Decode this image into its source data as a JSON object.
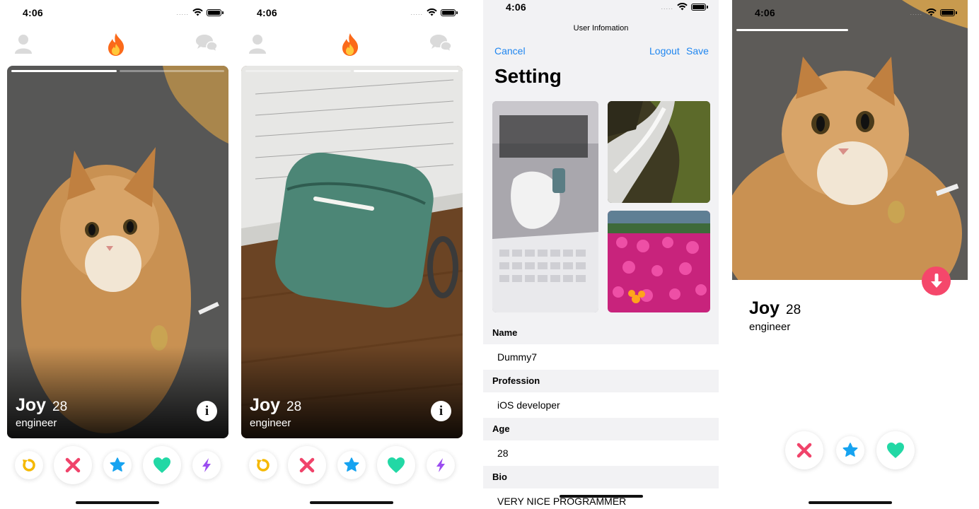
{
  "status_bar": {
    "time": "4:06",
    "signal_dots": "....."
  },
  "card": {
    "name": "Joy",
    "age": "28",
    "job": "engineer",
    "info_glyph": "i"
  },
  "settings": {
    "sheet_title": "User Infomation",
    "cancel_label": "Cancel",
    "logout_label": "Logout",
    "save_label": "Save",
    "title": "Setting",
    "sections": [
      {
        "header": "Name",
        "value": "Dummy7"
      },
      {
        "header": "Profession",
        "value": "iOS developer"
      },
      {
        "header": "Age",
        "value": "28"
      },
      {
        "header": "Bio",
        "value": "VERY NICE PROGRAMMER"
      }
    ]
  },
  "detail": {
    "name": "Joy",
    "age": "28",
    "job": "engineer"
  },
  "icons": {
    "top": [
      "user-icon",
      "flame-icon",
      "chat-icon"
    ],
    "actions": [
      "rewind-icon",
      "nope-icon",
      "super-like-icon",
      "like-icon",
      "boost-icon"
    ],
    "detail_actions": [
      "nope-icon",
      "super-like-icon",
      "like-icon"
    ]
  },
  "colors": {
    "accent_blue": "#1f86f0",
    "rewind": "#f5b800",
    "nope": "#f0436a",
    "super_like": "#16a3f0",
    "like": "#22d8a5",
    "boost": "#9b4df0",
    "flame": "#fb6a1a",
    "down_button": "#f5476b"
  }
}
